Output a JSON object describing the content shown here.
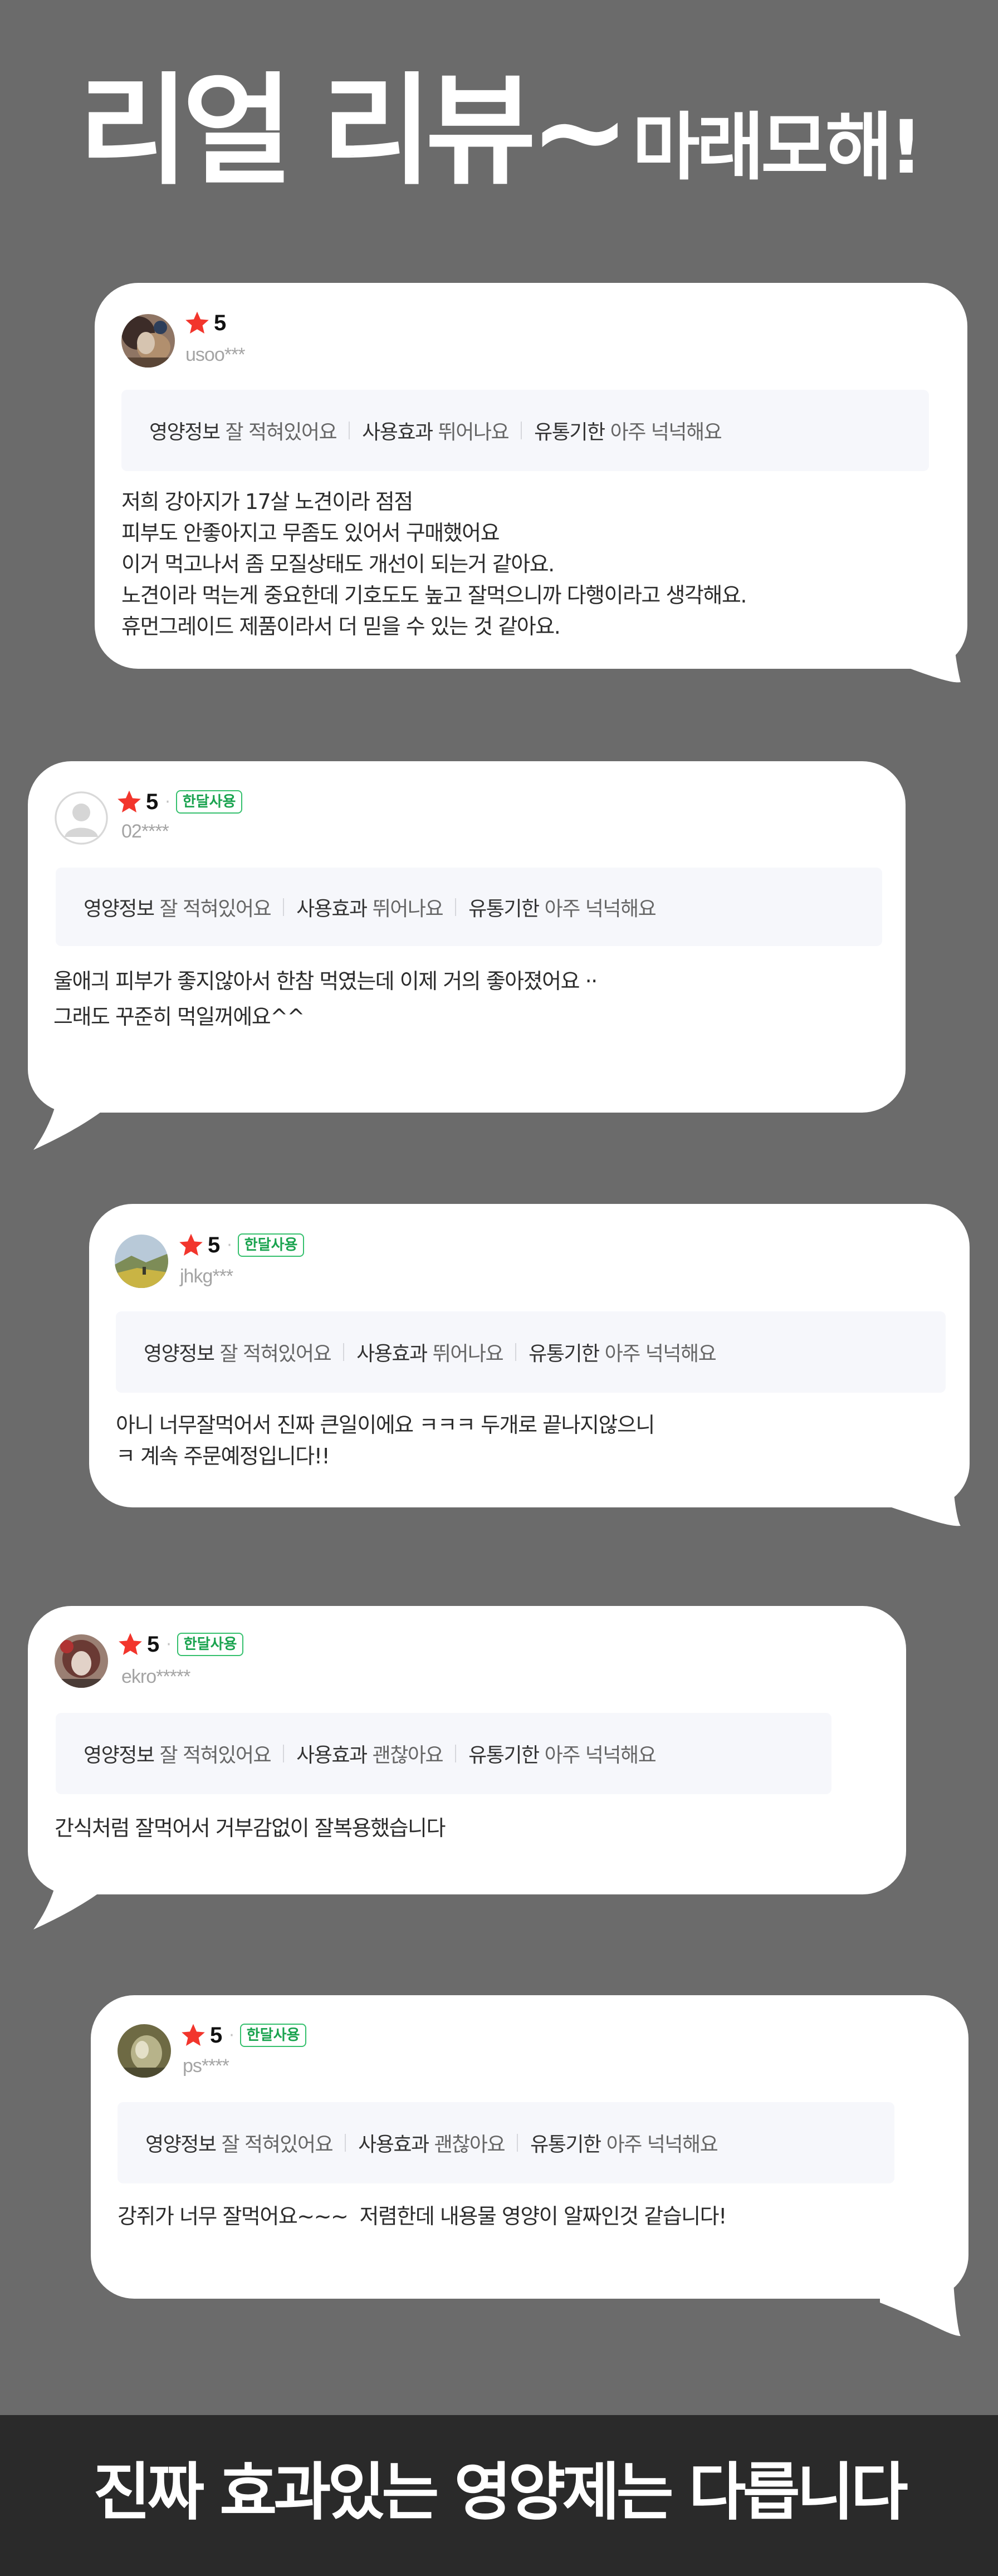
{
  "headline": {
    "main": "리얼 리뷰~",
    "sub": "마래모해!"
  },
  "colors": {
    "background": "#6b6b6b",
    "footer_background": "#2a2a2a",
    "star": "#f2352c",
    "badge_green": "#35c06d"
  },
  "attribute_keys": {
    "nutrition": "영양정보",
    "effect": "사용효과",
    "expiry": "유통기한"
  },
  "reviews": [
    {
      "rating": "5",
      "star_icon": "star-icon",
      "badge": "",
      "user_id": "usoo***",
      "avatar": "dog-photo-avatar",
      "attributes": {
        "nutrition": "잘 적혀있어요",
        "effect": "뛰어나요",
        "expiry": "아주 넉넉해요"
      },
      "lines": [
        "저희 강아지가 17살 노견이라 점점",
        "피부도 안좋아지고 무좀도 있어서 구매했어요",
        "이거 먹고나서 좀 모질상태도 개선이 되는거 같아요.",
        "노견이라 먹는게 중요한데 기호도도 높고 잘먹으니까 다행이라고 생각해요.",
        "휴먼그레이드 제품이라서 더 믿을 수 있는 것 같아요."
      ]
    },
    {
      "rating": "5",
      "star_icon": "star-icon",
      "badge": "한달사용",
      "user_id": "02****",
      "avatar": "default-user-avatar",
      "attributes": {
        "nutrition": "잘 적혀있어요",
        "effect": "뛰어나요",
        "expiry": "아주 넉넉해요"
      },
      "lines": [
        "울애긔 피부가 좋지않아서 한참 먹였는데 이제 거의 좋아졌어요 ··",
        "그래도 꾸준히 먹일꺼에요^^"
      ]
    },
    {
      "rating": "5",
      "star_icon": "star-icon",
      "badge": "한달사용",
      "user_id": "jhkg***",
      "avatar": "landscape-photo-avatar",
      "attributes": {
        "nutrition": "잘 적혀있어요",
        "effect": "뛰어나요",
        "expiry": "아주 넉넉해요"
      },
      "lines": [
        "아니 너무잘먹어서 진짜 큰일이에요 ㅋㅋㅋ 두개로 끝나지않으니",
        "ㅋ 계속 주문예정입니다!!"
      ]
    },
    {
      "rating": "5",
      "star_icon": "star-icon",
      "badge": "한달사용",
      "user_id": "ekro*****",
      "avatar": "dog-photo-avatar",
      "attributes": {
        "nutrition": "잘 적혀있어요",
        "effect": "괜찮아요",
        "expiry": "아주 넉넉해요"
      },
      "lines": [
        "간식처럼 잘먹어서 거부감없이 잘복용했습니다"
      ]
    },
    {
      "rating": "5",
      "star_icon": "star-icon",
      "badge": "한달사용",
      "user_id": "ps****",
      "avatar": "pet-photo-avatar",
      "attributes": {
        "nutrition": "잘 적혀있어요",
        "effect": "괜찮아요",
        "expiry": "아주 넉넉해요"
      },
      "lines": [
        "강쥐가 너무 잘먹어요~~~  저렴한데 내용물 영양이 알짜인것 같습니다!"
      ]
    }
  ],
  "footer": {
    "text": "진짜 효과있는 영양제는 다릅니다"
  }
}
